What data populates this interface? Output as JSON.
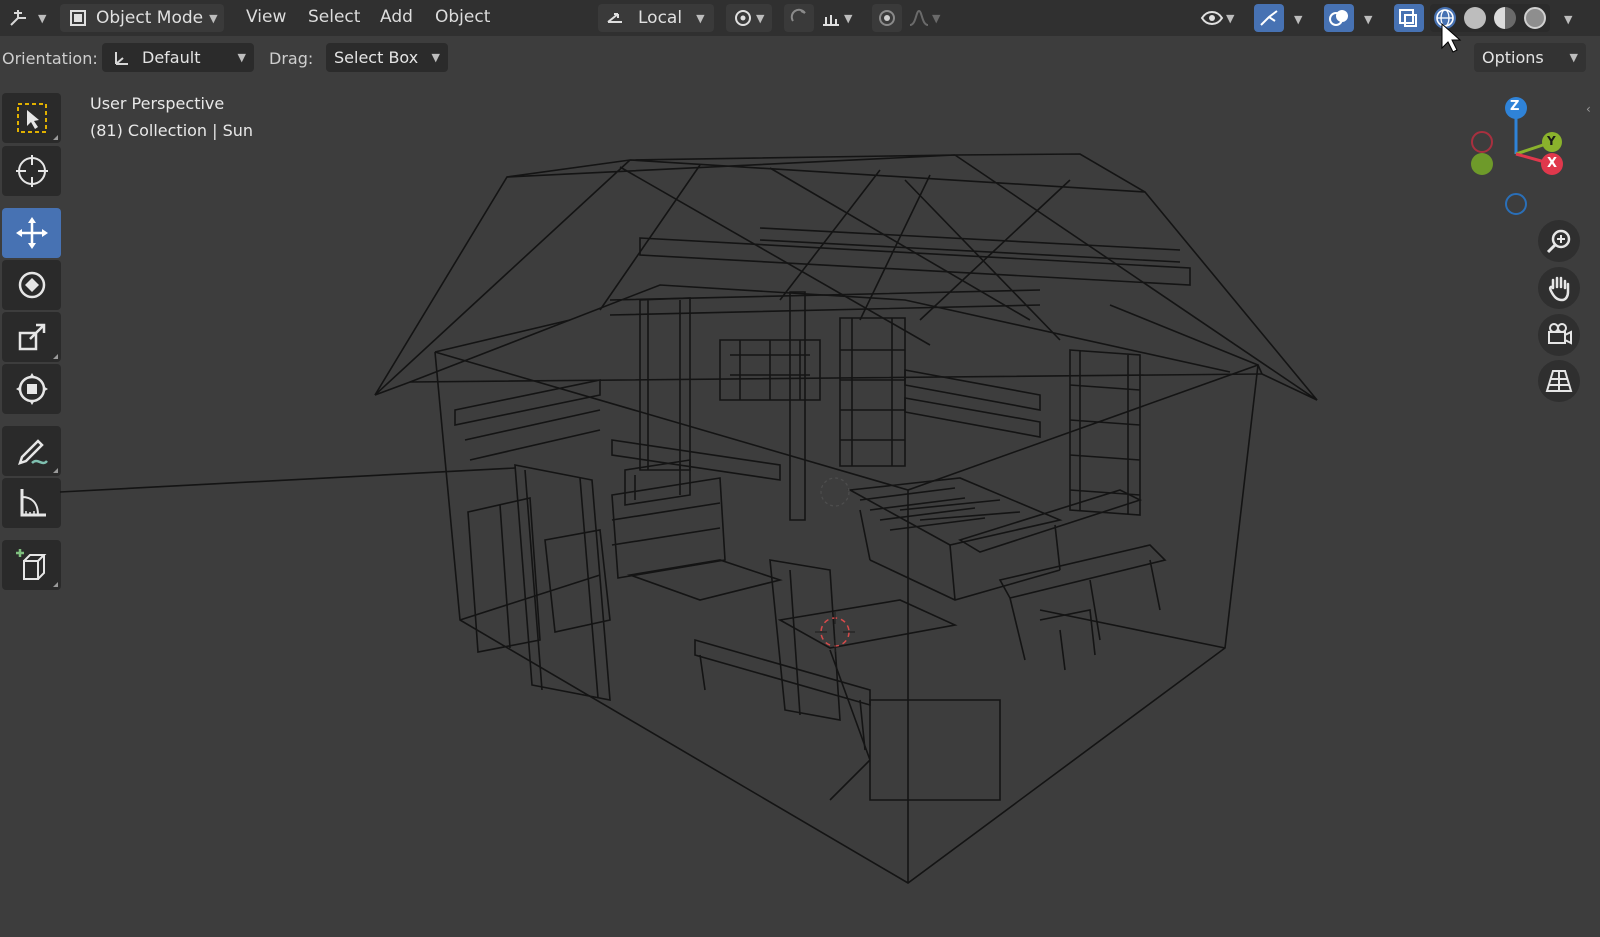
{
  "header": {
    "editor_type_icon": "3d-viewport-icon",
    "mode": "Object Mode",
    "menus": [
      "View",
      "Select",
      "Add",
      "Object"
    ],
    "transform_space": "Local",
    "accent_color": "#4772b3"
  },
  "tool_settings": {
    "orientation_label": "Orientation:",
    "orientation_value": "Default",
    "drag_label": "Drag:",
    "drag_value": "Select Box",
    "options_label": "Options"
  },
  "viewport": {
    "view_name": "User Perspective",
    "collection_info": "(81) Collection | Sun",
    "shading_mode": "wireframe"
  },
  "gizmo": {
    "x_label": "X",
    "y_label": "Y",
    "z_label": "Z",
    "x_color": "#e0384c",
    "y_color": "#8ab22c",
    "z_color": "#2f83d8"
  },
  "tools": [
    "select-box",
    "cursor",
    "move",
    "rotate",
    "scale",
    "transform",
    "annotate",
    "measure",
    "add-cube"
  ]
}
